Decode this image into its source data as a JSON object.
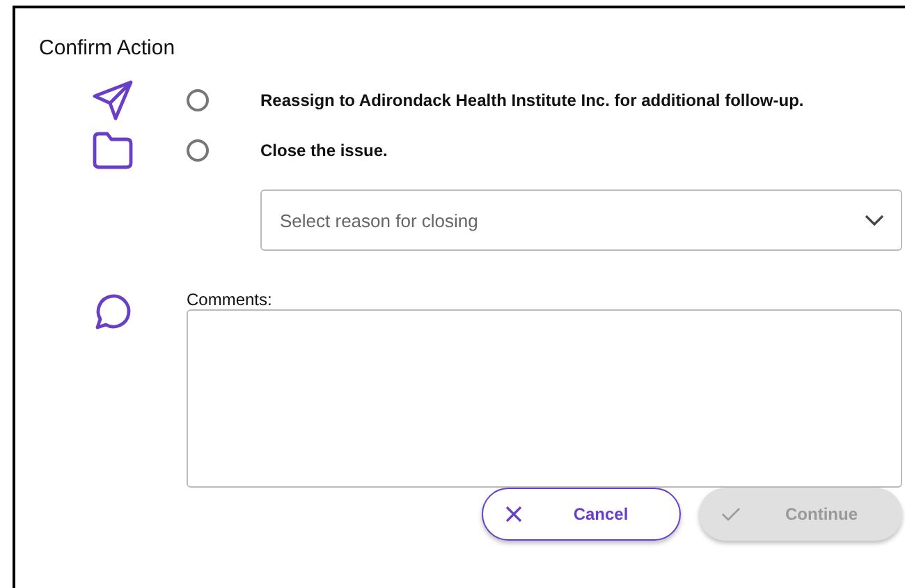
{
  "dialog": {
    "title": "Confirm Action"
  },
  "options": [
    {
      "kind": "send",
      "label": "Reassign to Adirondack Health Institute Inc. for additional follow-up.",
      "selected": false
    },
    {
      "kind": "folder",
      "label": "Close the issue.",
      "selected": false
    }
  ],
  "reason_select": {
    "placeholder": "Select reason for closing"
  },
  "comments": {
    "label": "Comments:"
  },
  "buttons": [
    {
      "kind": "cancel",
      "label": "Cancel",
      "disabled": false
    },
    {
      "kind": "confirm",
      "label": "Continue",
      "disabled": true
    }
  ]
}
